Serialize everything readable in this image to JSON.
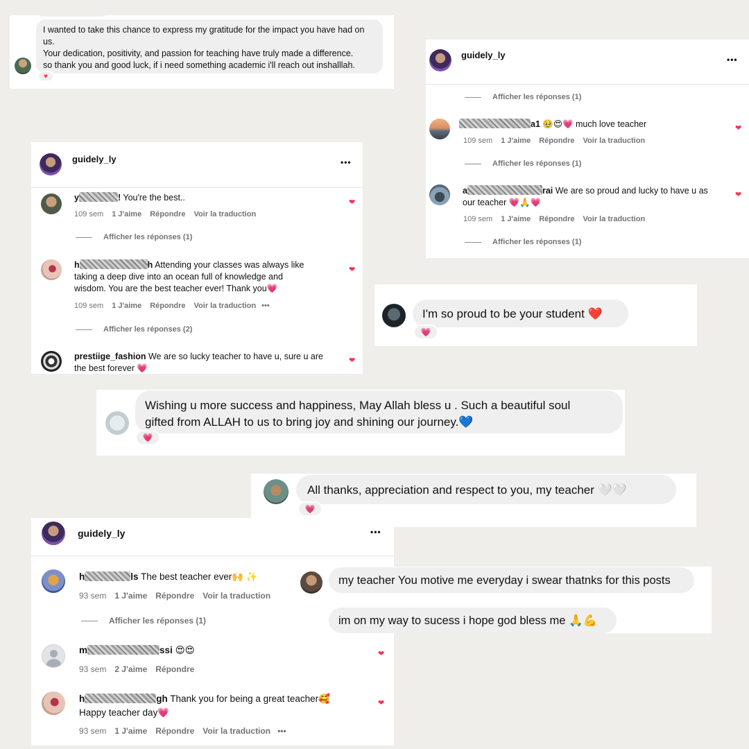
{
  "colors": {
    "background": "#efeeeb",
    "heart": "#ff2f55",
    "bubble": "#efefef"
  },
  "msg_gratitude": {
    "lines": [
      "I wanted to take this chance to express my gratitude for the impact you have had on",
      "us.",
      "Your dedication, positivity, and passion for teaching have truly made a difference.",
      "so thank you and good luck, if i need something academic i'll reach out inshalllah."
    ],
    "reaction": "♥"
  },
  "post1": {
    "username": "guidely_ly",
    "more": "•••",
    "comments": [
      {
        "user_prefix": "y",
        "user_suffix": "!",
        "text": "You're the best..",
        "time": "109 sem",
        "likes": "1 J'aime",
        "reply": "Répondre",
        "translate": "Voir la traduction",
        "replies": "Afficher les réponses (1)"
      },
      {
        "user_prefix": "h",
        "user_suffix": "h",
        "lines": [
          "Attending your classes was always like",
          "taking a deep dive into an ocean full of knowledge and",
          "wisdom. You are the best teacher ever! Thank you💗"
        ],
        "time": "109 sem",
        "likes": "1 J'aime",
        "reply": "Répondre",
        "translate": "Voir la traduction",
        "more": "•••",
        "replies": "Afficher les réponses (2)"
      },
      {
        "user": "prestiige_fashion",
        "lines": [
          "We are so lucky teacher to have u, sure u are",
          "the best forever 💗"
        ]
      }
    ]
  },
  "post2": {
    "username": "guidely_ly",
    "more": "•••",
    "top_replies": "Afficher les réponses (1)",
    "comments": [
      {
        "user_suffix": "a1",
        "text": "🥹😍💗 much love teacher",
        "time": "109 sem",
        "likes": "1 J'aime",
        "reply": "Répondre",
        "translate": "Voir la traduction",
        "replies": "Afficher les réponses (1)"
      },
      {
        "user_prefix": "a",
        "user_suffix": "rai",
        "lines": [
          "We are so proud and lucky to have u as",
          "our teacher 💗🙏💗"
        ],
        "time": "109 sem",
        "likes": "1 J'aime",
        "reply": "Répondre",
        "translate": "Voir la traduction",
        "replies": "Afficher les réponses (1)"
      }
    ]
  },
  "msg_proud": {
    "text": "I'm so proud to be your student ❤️",
    "reaction": "💗"
  },
  "msg_wishing": {
    "lines": [
      "Wishing u more success and happiness, May Allah bless u . Such a beautiful soul",
      "gifted from ALLAH to us to bring joy and shining our journey.💙"
    ],
    "reaction": "💗"
  },
  "msg_thanks": {
    "text": "All thanks, appreciation and respect to you, my teacher 🤍🤍",
    "reaction": "💗"
  },
  "post3": {
    "username": "guidely_ly",
    "more": "•••",
    "comments": [
      {
        "user_prefix": "h",
        "user_suffix": "ls",
        "text": "The best teacher ever🙌 ✨",
        "time": "93 sem",
        "likes": "1 J'aime",
        "reply": "Répondre",
        "translate": "Voir la traduction",
        "replies": "Afficher les réponses (1)"
      },
      {
        "user_prefix": "m",
        "user_suffix": "ssi",
        "text": "😍😍",
        "time": "93 sem",
        "likes": "2 J'aime",
        "reply": "Répondre"
      },
      {
        "user_prefix": "h",
        "user_suffix": "gh",
        "lines": [
          "Thank you for being a great teacher🥰",
          "Happy teacher day💗"
        ],
        "time": "93 sem",
        "likes": "1 J'aime",
        "reply": "Répondre",
        "translate": "Voir la traduction",
        "more": "•••"
      }
    ]
  },
  "msg_motive": {
    "line1": "my teacher You motive me everyday i swear thatnks for this posts",
    "line2": "im on my way to sucess i hope god bless me 🙏💪"
  }
}
